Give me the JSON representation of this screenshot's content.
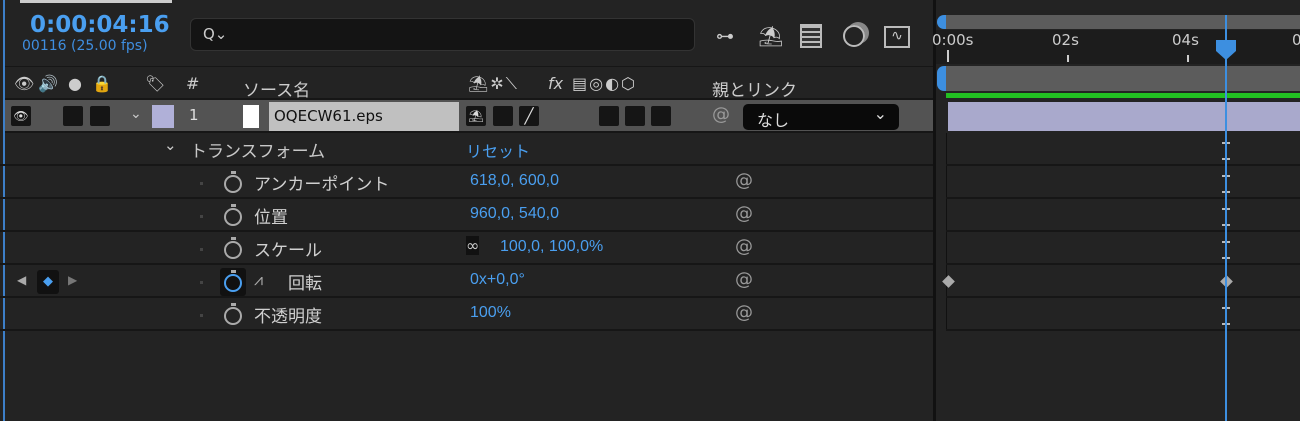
{
  "header": {
    "timecode": "0:00:04:16",
    "frames": "00116 (25.00 fps)",
    "search_placeholder": "",
    "search_icon": "Q⌄"
  },
  "columns": {
    "source_name": "ソース名",
    "number": "#",
    "parent_link": "親とリンク",
    "fx": "fx"
  },
  "layer": {
    "index": "1",
    "name": "OQECW61.eps",
    "parent": "なし",
    "label_color": "#b0b0d8"
  },
  "transform": {
    "label": "トランスフォーム",
    "reset": "リセット",
    "properties": [
      {
        "name": "アンカーポイント",
        "value": "618,0, 600,0"
      },
      {
        "name": "位置",
        "value": "960,0, 540,0"
      },
      {
        "name": "スケール",
        "value": "100,0, 100,0%"
      },
      {
        "name": "回転",
        "value": "0x+0,0°"
      },
      {
        "name": "不透明度",
        "value": "100%"
      }
    ]
  },
  "ruler": {
    "labels": [
      "0:00s",
      "02s",
      "04s",
      "0"
    ]
  },
  "colors": {
    "accent": "#4a9ff0",
    "layer_bar": "#a9a9cc",
    "work_area": "#22c022"
  }
}
